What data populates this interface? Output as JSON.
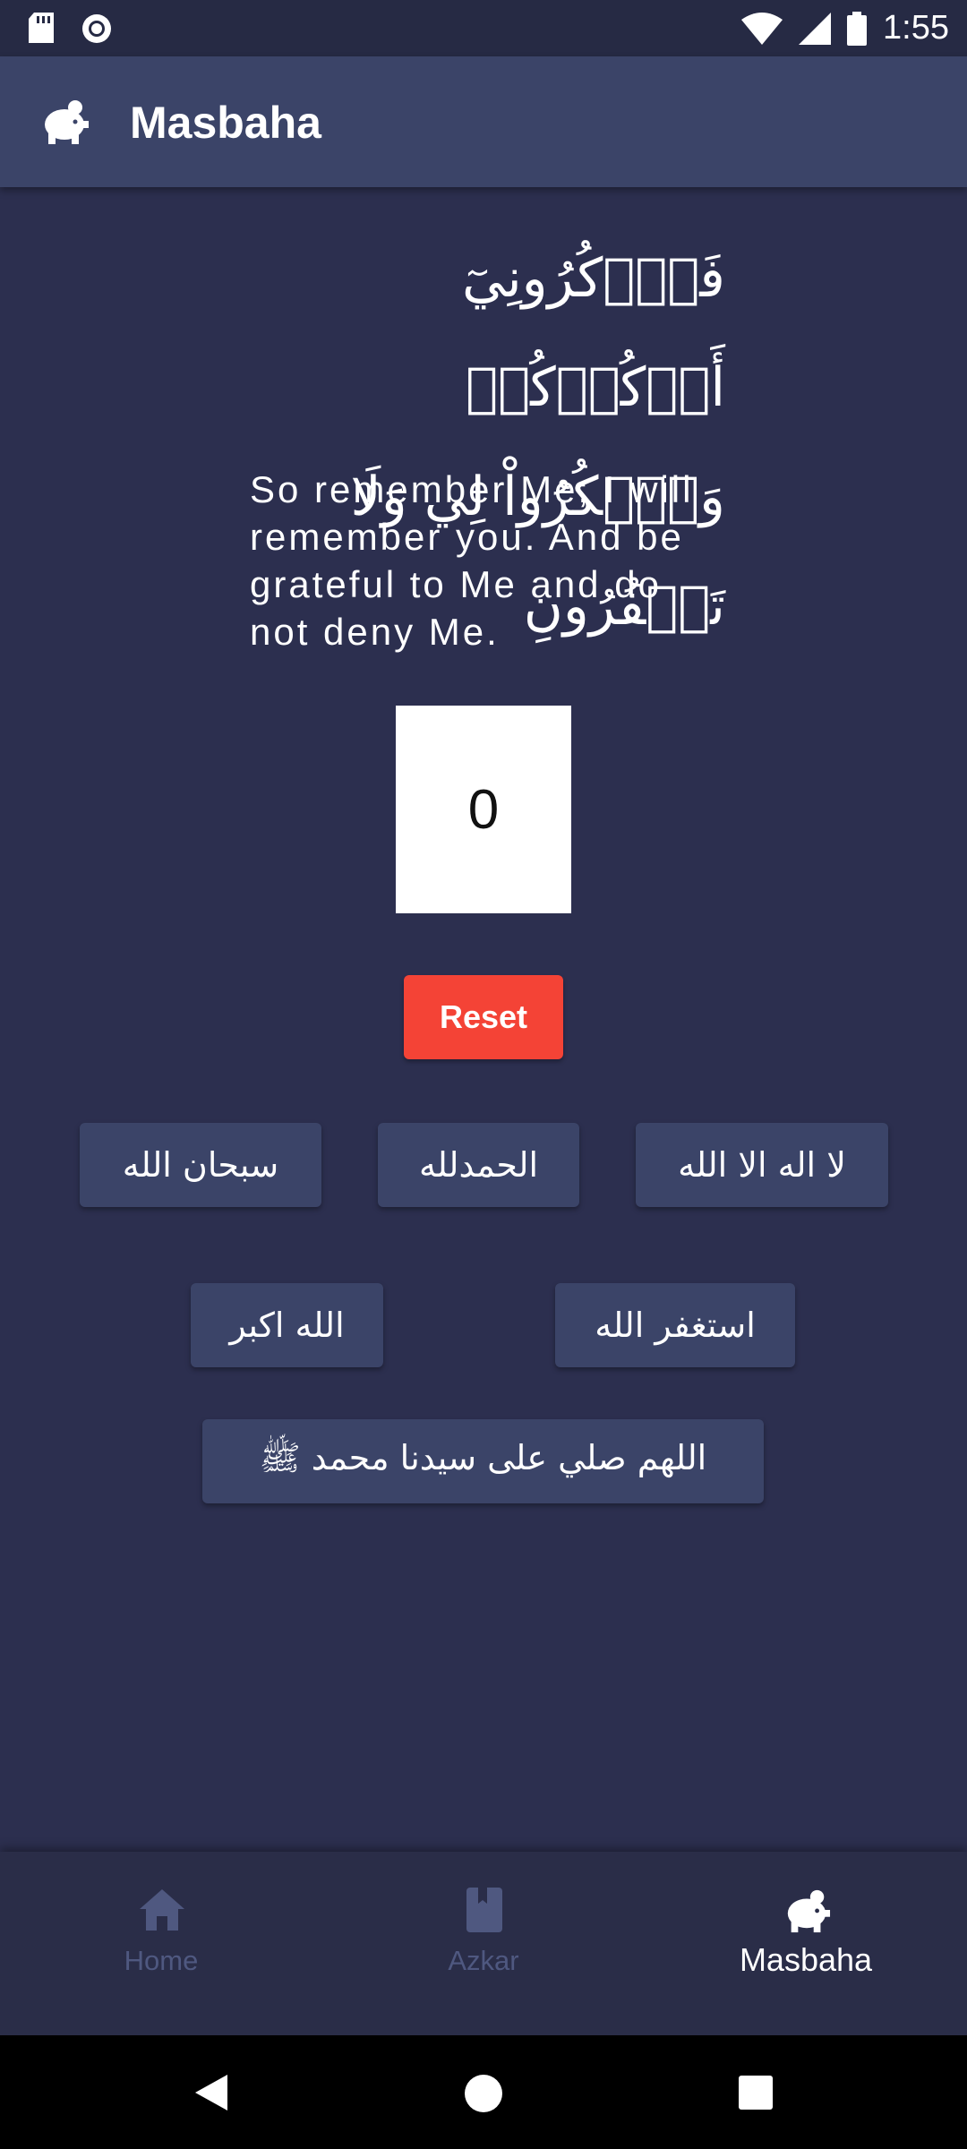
{
  "status_bar": {
    "time": "1:55"
  },
  "app_bar": {
    "title": "Masbaha",
    "icon": "piggy-bank-icon"
  },
  "verse": {
    "arabic_line1": "فَٱذۡكُرُونِيٓ أَذۡكُرۡكُمۡ",
    "arabic_line2": "وَٱشۡكُرُواْ لِي وَلَا تَكۡفُرُونِ",
    "english": "So remember Me; I will remember you. And be grateful to Me and do not deny Me."
  },
  "counter": {
    "value": "0"
  },
  "reset": {
    "label": "Reset",
    "color": "#f44336"
  },
  "azkar_buttons": [
    {
      "label": "سبحان الله"
    },
    {
      "label": "الحمدلله"
    },
    {
      "label": "لا اله الا الله"
    },
    {
      "label": "الله اكبر"
    },
    {
      "label": "استغفر الله"
    },
    {
      "label": "اللهم صلي على سيدنا محمد ﷺ"
    }
  ],
  "bottom_nav": {
    "items": [
      {
        "label": "Home",
        "icon": "home-icon",
        "active": false
      },
      {
        "label": "Azkar",
        "icon": "book-icon",
        "active": false
      },
      {
        "label": "Masbaha",
        "icon": "piggy-bank-icon",
        "active": true
      }
    ]
  },
  "colors": {
    "background": "#2c2f4f",
    "app_bar": "#3b4468",
    "button": "#3b4468",
    "inactive_nav": "#4f5880"
  }
}
